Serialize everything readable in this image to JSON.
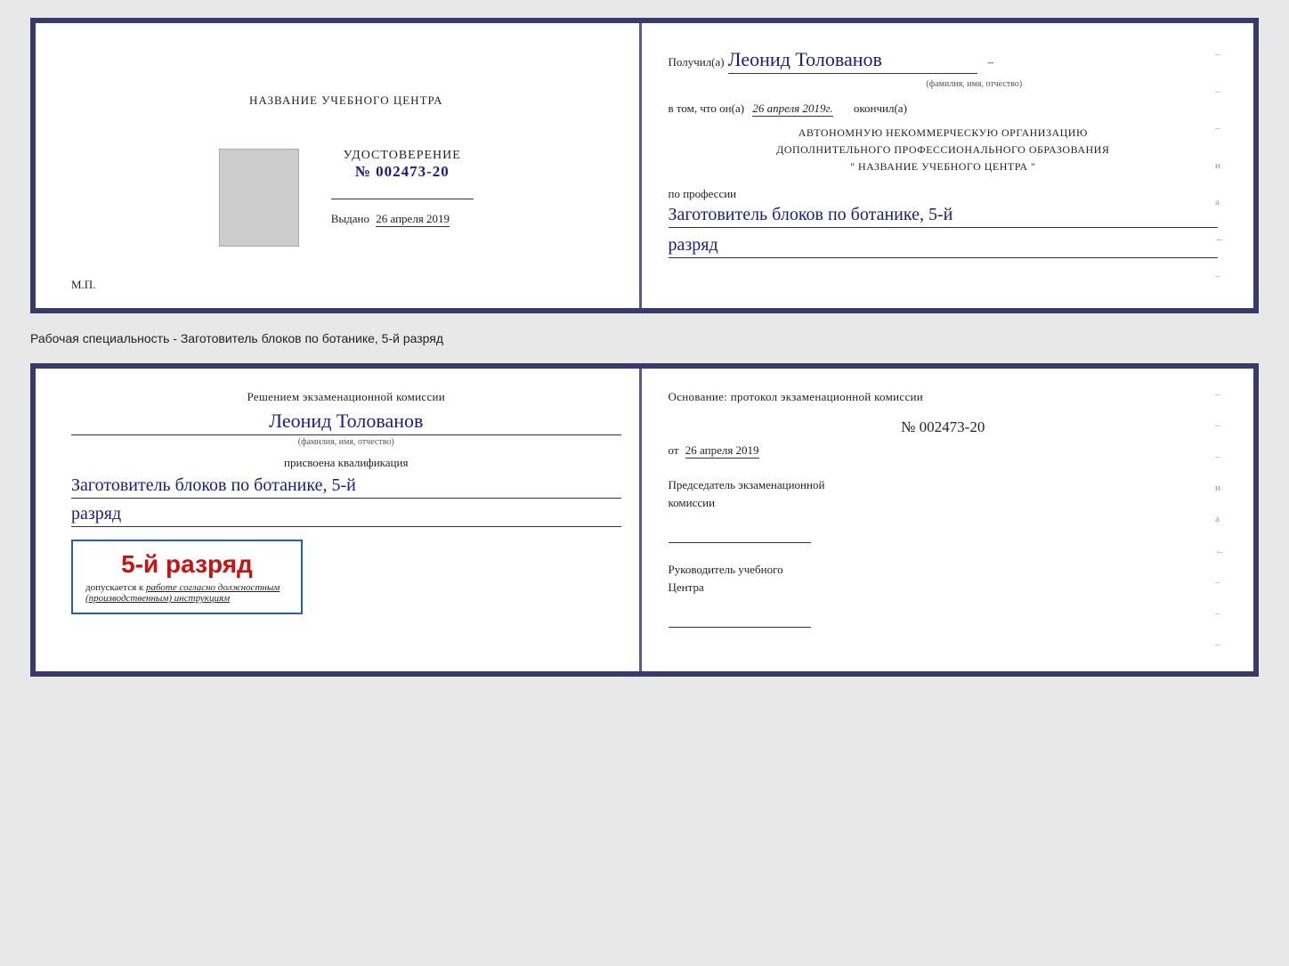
{
  "top_document": {
    "left": {
      "center_name": "НАЗВАНИЕ УЧЕБНОГО ЦЕНТРА",
      "udostoverenie_title": "УДОСТОВЕРЕНИЕ",
      "number_prefix": "№",
      "number": "002473-20",
      "vydano_label": "Выдано",
      "vydano_date": "26 апреля 2019",
      "mp_label": "М.П."
    },
    "right": {
      "poluchil_label": "Получил(а)",
      "recipient_name": "Леонид Толованов",
      "fio_subtitle": "(фамилия, имя, отчество)",
      "v_tom_label": "в том, что он(а)",
      "date_value": "26 апреля 2019г.",
      "okonchil_label": "окончил(а)",
      "org_line1": "АВТОНОМНУЮ НЕКОММЕРЧЕСКУЮ ОРГАНИЗАЦИЮ",
      "org_line2": "ДОПОЛНИТЕЛЬНОГО ПРОФЕССИОНАЛЬНОГО ОБРАЗОВАНИЯ",
      "org_quote": "\" НАЗВАНИЕ УЧЕБНОГО ЦЕНТРА \"",
      "po_professii_label": "по профессии",
      "profession_value": "Заготовитель блоков по ботанике, 5-й",
      "razryad_value": "разряд"
    }
  },
  "specialty_label": "Рабочая специальность - Заготовитель блоков по ботанике, 5-й разряд",
  "bottom_document": {
    "left": {
      "decision_text": "Решением экзаменационной комиссии",
      "person_name": "Леонид Толованов",
      "fio_subtitle": "(фамилия, имя, отчество)",
      "prisvoena_label": "присвоена квалификация",
      "kvalif_value": "Заготовитель блоков по ботанике, 5-й",
      "razryad_value": "разряд",
      "stamp_grade": "5-й разряд",
      "stamp_admission_prefix": "допускается к",
      "stamp_admission_italic": "работе согласно должностным (производственным) инструкциям"
    },
    "right": {
      "osnov_label": "Основание: протокол экзаменационной комиссии",
      "number_prefix": "№",
      "protocol_number": "002473-20",
      "ot_label": "от",
      "ot_date": "26 апреля 2019",
      "chairman_title_line1": "Председатель экзаменационной",
      "chairman_title_line2": "комиссии",
      "head_title_line1": "Руководитель учебного",
      "head_title_line2": "Центра"
    }
  },
  "edge_dashes": [
    "–",
    "–",
    "–",
    "–",
    "–",
    "и",
    "а",
    "←",
    "–",
    "–",
    "–",
    "–",
    "–"
  ]
}
